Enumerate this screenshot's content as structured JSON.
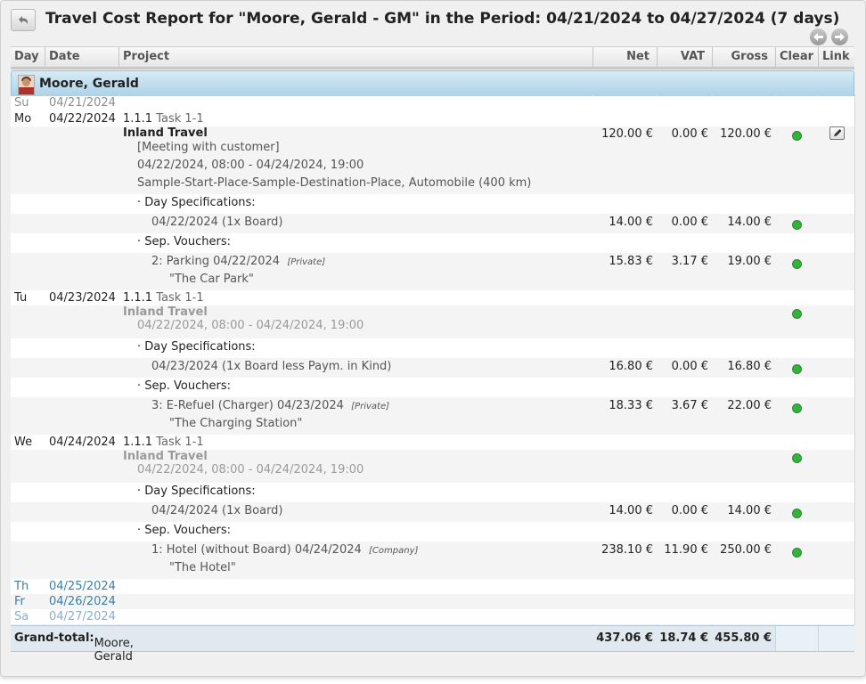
{
  "window": {
    "title": "Travel Cost Report for \"Moore, Gerald - GM\" in the Period: 04/21/2024 to 04/27/2024 (7 days)"
  },
  "columns": {
    "day": "Day",
    "date": "Date",
    "project": "Project",
    "net": "Net",
    "vat": "VAT",
    "gross": "Gross",
    "clear": "Clear",
    "link": "Link"
  },
  "employee": {
    "name": "Moore, Gerald"
  },
  "days": {
    "su": {
      "day": "Su",
      "date": "04/21/2024"
    },
    "mo": {
      "day": "Mo",
      "date": "04/22/2024",
      "task_code": "1.1.1",
      "task_name": "Task 1-1",
      "trip_title": "Inland Travel",
      "purpose": "[Meeting with customer]",
      "trip_period": "04/22/2024, 08:00 - 04/24/2024, 19:00",
      "route": "Sample-Start-Place-Sample-Destination-Place, Automobile  (400 km)",
      "trip_net": "120.00 €",
      "trip_vat": "0.00 €",
      "trip_gross": "120.00 €",
      "day_spec_header": "· Day Specifications:",
      "day_spec": "04/22/2024 (1x Board)",
      "day_spec_net": "14.00 €",
      "day_spec_vat": "0.00 €",
      "day_spec_gross": "14.00 €",
      "vouchers_header": "· Sep. Vouchers:",
      "voucher": "2:  Parking  04/22/2024",
      "voucher_tag": "[Private]",
      "voucher_vendor": "\"The Car Park\"",
      "voucher_net": "15.83 €",
      "voucher_vat": "3.17 €",
      "voucher_gross": "19.00 €"
    },
    "tu": {
      "day": "Tu",
      "date": "04/23/2024",
      "task_code": "1.1.1",
      "task_name": "Task 1-1",
      "trip_title": "Inland Travel",
      "trip_period": "04/22/2024, 08:00 - 04/24/2024, 19:00",
      "day_spec_header": "· Day Specifications:",
      "day_spec": "04/23/2024 (1x Board less Paym. in Kind)",
      "day_spec_net": "16.80 €",
      "day_spec_vat": "0.00 €",
      "day_spec_gross": "16.80 €",
      "vouchers_header": "· Sep. Vouchers:",
      "voucher": "3:  E-Refuel (Charger)  04/23/2024",
      "voucher_tag": "[Private]",
      "voucher_vendor": "\"The Charging Station\"",
      "voucher_net": "18.33 €",
      "voucher_vat": "3.67 €",
      "voucher_gross": "22.00 €"
    },
    "we": {
      "day": "We",
      "date": "04/24/2024",
      "task_code": "1.1.1",
      "task_name": "Task 1-1",
      "trip_title": "Inland Travel",
      "trip_period": "04/22/2024, 08:00 - 04/24/2024, 19:00",
      "day_spec_header": "· Day Specifications:",
      "day_spec": "04/24/2024 (1x Board)",
      "day_spec_net": "14.00 €",
      "day_spec_vat": "0.00 €",
      "day_spec_gross": "14.00 €",
      "vouchers_header": "· Sep. Vouchers:",
      "voucher": "1:  Hotel (without Board)  04/24/2024",
      "voucher_tag": "[Company]",
      "voucher_vendor": "\"The Hotel\"",
      "voucher_net": "238.10 €",
      "voucher_vat": "11.90 €",
      "voucher_gross": "250.00 €"
    },
    "th": {
      "day": "Th",
      "date": "04/25/2024"
    },
    "fr": {
      "day": "Fr",
      "date": "04/26/2024"
    },
    "sa": {
      "day": "Sa",
      "date": "04/27/2024"
    }
  },
  "grand_total": {
    "label": "Grand-total:",
    "name": "Moore, Gerald",
    "net": "437.06 €",
    "vat": "18.74 €",
    "gross": "455.80 €"
  },
  "icons": {
    "back": "undo-arrow-icon",
    "prev": "arrow-left-icon",
    "next": "arrow-right-icon",
    "clear": "green-check-dot-icon",
    "link": "edit-link-icon",
    "avatar": "person-avatar-icon"
  },
  "colors": {
    "header_bar": "#a9d0e6",
    "clear_dot": "#32b33a",
    "weekend_text": "#8d8d8d",
    "future_text": "#3a7ea8",
    "total_bg": "#dfe9ef"
  }
}
